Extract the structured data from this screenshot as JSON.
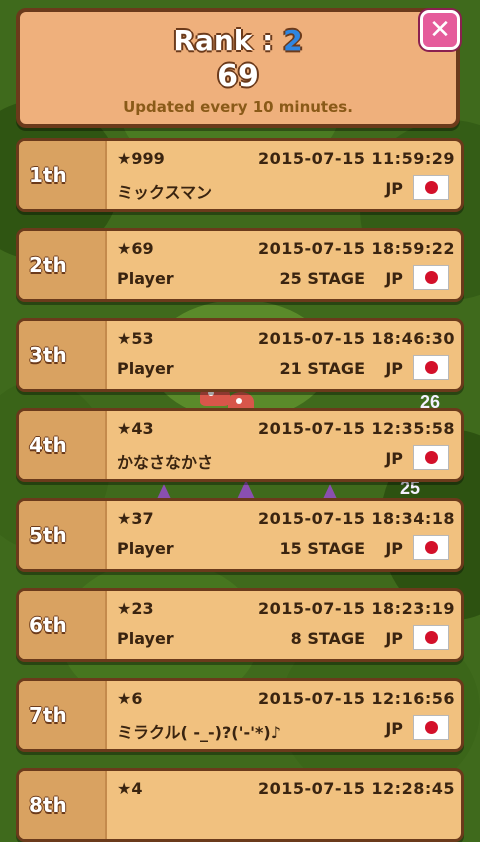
{
  "header": {
    "rank_label": "Rank :",
    "rank_value": "2",
    "score": "69",
    "note": "Updated every 10 minutes."
  },
  "close_symbol": "✕",
  "rows": [
    {
      "rank": "1th",
      "stars": "★999",
      "timestamp": "2015-07-15 11:59:29",
      "player": "ミックスマン",
      "stage": "",
      "country": "JP"
    },
    {
      "rank": "2th",
      "stars": "★69",
      "timestamp": "2015-07-15 18:59:22",
      "player": "Player",
      "stage": "25 STAGE",
      "country": "JP"
    },
    {
      "rank": "3th",
      "stars": "★53",
      "timestamp": "2015-07-15 18:46:30",
      "player": "Player",
      "stage": "21 STAGE",
      "country": "JP"
    },
    {
      "rank": "4th",
      "stars": "★43",
      "timestamp": "2015-07-15 12:35:58",
      "player": "かなさなかさ",
      "stage": "",
      "country": "JP"
    },
    {
      "rank": "5th",
      "stars": "★37",
      "timestamp": "2015-07-15 18:34:18",
      "player": "Player",
      "stage": "15 STAGE",
      "country": "JP"
    },
    {
      "rank": "6th",
      "stars": "★23",
      "timestamp": "2015-07-15 18:23:19",
      "player": "Player",
      "stage": "8 STAGE",
      "country": "JP"
    },
    {
      "rank": "7th",
      "stars": "★6",
      "timestamp": "2015-07-15 12:16:56",
      "player": "ミラクル( -_-)?('-'*)♪",
      "stage": "",
      "country": "JP"
    },
    {
      "rank": "8th",
      "stars": "★4",
      "timestamp": "2015-07-15 12:28:45",
      "player": "",
      "stage": "",
      "country": ""
    }
  ],
  "background": {
    "tags": [
      "26",
      "25"
    ]
  },
  "colors": {
    "panel": "#efb07c",
    "row": "#f1c17f",
    "border": "#6b3a1b",
    "rank_value": "#2f86e0",
    "close_button": "#e55c9b",
    "flag_red": "#d3102a"
  }
}
